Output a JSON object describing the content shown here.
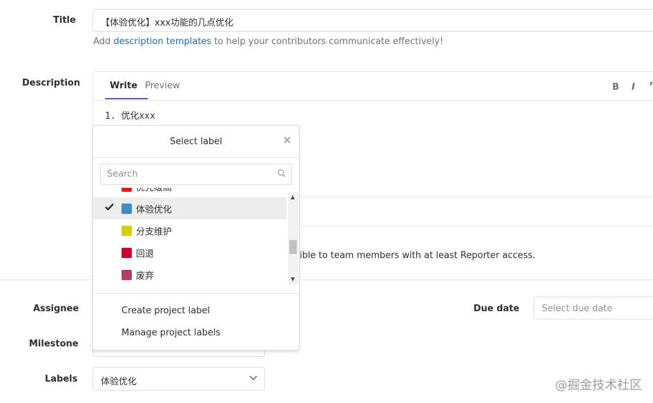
{
  "form": {
    "title_label": "Title",
    "title_value": "【体验优化】xxx功能的几点优化",
    "help_prefix": "Add",
    "help_link": "description templates",
    "help_suffix": "to help your contributors communicate effectively!",
    "description_label": "Description",
    "tabs": {
      "write": "Write",
      "preview": "Preview"
    },
    "toolbar": {
      "bold": "B",
      "italic": "I",
      "quote": "”"
    },
    "description_text": "1. 优化xxx",
    "visibility_note": "visible to team members with at least Reporter access.",
    "assignee_label": "Assignee",
    "milestone_label": "Milestone",
    "labels_label": "Labels",
    "labels_value": "体验优化",
    "due_date_label": "Due date",
    "due_date_placeholder": "Select due date"
  },
  "dropdown": {
    "title": "Select label",
    "search_placeholder": "Search",
    "items": [
      {
        "label": "优先级高",
        "color": "#e31e1e",
        "selected": false
      },
      {
        "label": "体验优化",
        "color": "#428bca",
        "selected": true
      },
      {
        "label": "分支维护",
        "color": "#d1d100",
        "selected": false
      },
      {
        "label": "回退",
        "color": "#cc0033",
        "selected": false
      },
      {
        "label": "废弃",
        "color": "#ad4363",
        "selected": false
      }
    ],
    "create_link": "Create project label",
    "manage_link": "Manage project labels"
  },
  "watermark": "@掘金技术社区"
}
